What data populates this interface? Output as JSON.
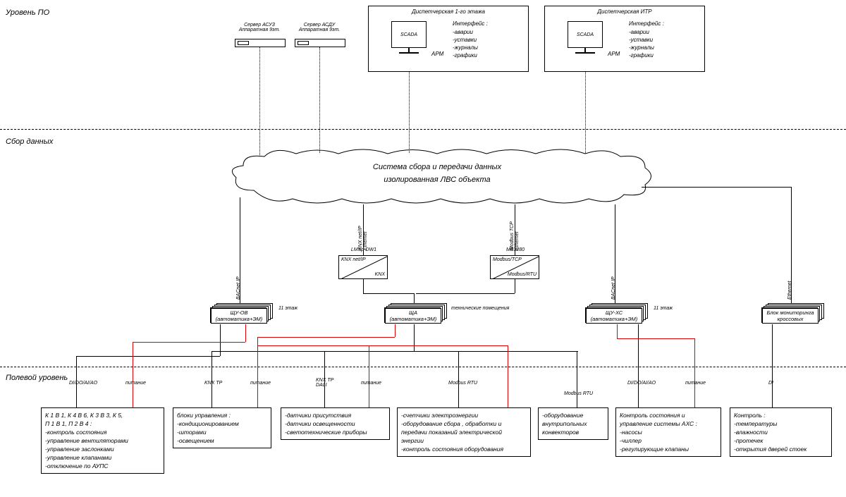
{
  "levels": {
    "sw": "Уровень ПО",
    "data": "Сбор данных",
    "field": "Полевой уровень"
  },
  "servers": {
    "s1": "Сервер АСУЗ\nАппаратная 9эт.",
    "s2": "Сервер АСДУ\nАппаратная 9эт."
  },
  "disp1": {
    "title": "Диспетчерская 1-го этажа",
    "arm": "АРМ",
    "if_title": "Интерфейс :",
    "if_items": "-аварии\n-уставки\n-журналы\n-графики",
    "scada": "SCADA"
  },
  "disp2": {
    "title": "Диспетчерская ИТР",
    "arm": "АРМ",
    "if_title": "Интерфейс :",
    "if_items": "-аварии\n-уставки\n-журналы\n-графики",
    "scada": "SCADA"
  },
  "cloud": {
    "l1": "Система сбора и передачи данных",
    "l2": "изолированная ЛВС объекта"
  },
  "conv": {
    "knx": {
      "name": "LMSp-DW1",
      "top": "KNX net/IP",
      "bot": "KNX"
    },
    "mb": {
      "name": "MB3280",
      "top": "Modbus/TCP",
      "bot": "Modbus/RTU"
    }
  },
  "cabs": {
    "ov": {
      "l1": "ЩУ-ОВ",
      "l2": "(автоматика+ЭМ)",
      "floor": "11 этаж"
    },
    "sha": {
      "l1": "ЩА",
      "l2": "(автоматика+ЭМ)",
      "floor": "технические помещения"
    },
    "xc": {
      "l1": "ЩУ-ХС",
      "l2": "(автоматика+ЭМ)",
      "floor": "11 этаж"
    },
    "mon": {
      "l1": "Блок мониторинга",
      "l2": "кроссовых"
    }
  },
  "proto": {
    "knxip": "KNX net/IP\nEthernet",
    "mbtcp": "Modbus TCP\nEthernet",
    "bacnet": "BACnet IP",
    "eth": "Ethernet",
    "knxtp": "KNX TP",
    "knxdali": "KNX TP\nDALI",
    "mbrtu": "Modbus RTU",
    "pwr": "питание",
    "dio": "DI/DO/AI/AO",
    "di": "DI"
  },
  "field": {
    "b1": "К 1 В 1,  К 4 В 6,  К 3 В 3,  К 5,\nП 1 В 1,  П 2  В 4 :\n-контроль состояния\n-управление вентиляторами\n-управление заслонками\n-управление клапанами\n-отключение по АУПС",
    "b2": "блоки управления :\n-кондиционированием\n-шторами\n-освещением",
    "b3": "-датчики присутствия\n-датчики освещенности\n-светотехнические приборы",
    "b4": "-счетчики электроэнергии\n-оборудование сбора , обработки и\nпередачи показаний электрической\nэнергии\n-контроль состояния оборудования",
    "b5": "-оборудование\nвнутрипольных\nконвекторов",
    "b6": "Контроль состояния и\nуправление системы АХС :\n-насосы\n-чиллер\n-регулирующие клапаны",
    "b7": "Контроль :\n-температуры\n-влажности\n-протечек\n-открытия дверей стоек"
  }
}
